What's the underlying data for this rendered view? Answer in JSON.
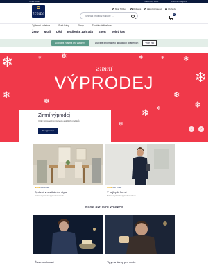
{
  "topbar": {
    "left": "Tchibo online",
    "items": [
      "Zákaznický servis",
      "Tchibo na instagramu"
    ]
  },
  "header": {
    "logo_text": "Tchibo",
    "search_placeholder": "Vyhledat produkty, nápady, ...",
    "utility": [
      {
        "label": "Moje Tchibo",
        "icon": "user-icon"
      },
      {
        "label": "Oblíbené",
        "icon": "heart-icon"
      },
      {
        "label": "Zákaznický servis",
        "icon": "chat-icon"
      },
      {
        "label": "Obchody",
        "icon": "pin-icon"
      }
    ],
    "cart_count": "1"
  },
  "nav_top": [
    "Týdenní kolekce",
    "Svět kávy",
    "Slevy",
    "Trvalá udržitelnost"
  ],
  "nav_main": [
    "Ženy",
    "Muži",
    "Děti",
    "Bydlení & Zahrada",
    "Sport",
    "Volný čas"
  ],
  "promo": {
    "tag": "Doprava zdarma pro všechny",
    "text": "Důležité informace o aktuálních opatřeních",
    "link": "Více info"
  },
  "hero": {
    "script_title": "Zimní",
    "big_title": "VÝPRODEJ",
    "card_title": "Zimní výprodej",
    "card_sub": "Velký výprodej zimní kolekce a dalších produktů",
    "card_button": "Do výprodeje"
  },
  "tiles": [
    {
      "tag_new": "Nové",
      "tag_brand": "Jen u nás",
      "title": "Bydlení v rustikálním stylu",
      "sub": "Nabídka platí do vyprodání zásob"
    },
    {
      "tag_new": "Nové",
      "tag_brand": "Jen u nás",
      "title": "V nejlepší formě",
      "sub": "Nabídka platí do vyprodání zásob"
    }
  ],
  "collections_title": "Naše aktuální kolekce",
  "collections": [
    {
      "title": "Čas na relaxaci"
    },
    {
      "title": "Tipy na dárky pro muže"
    }
  ],
  "colors": {
    "brand": "#0a1f55",
    "hero": "#f0394a",
    "promo": "#5b9c8a"
  }
}
